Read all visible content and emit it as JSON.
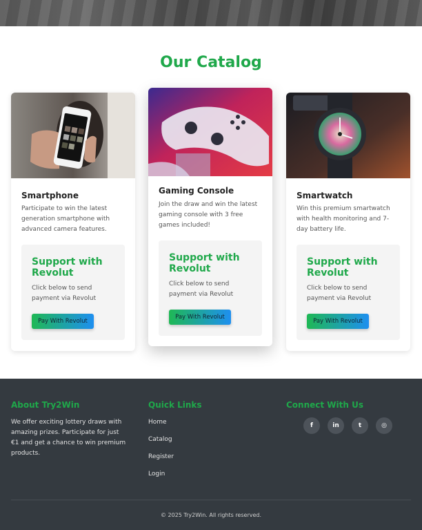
{
  "page": {
    "title": "Our Catalog"
  },
  "products": [
    {
      "title": "Smartphone",
      "description": "Participate to win the latest generation smartphone with advanced camera features.",
      "image_icon": "smartphone-photo",
      "support_title": "Support with Revolut",
      "support_text": "Click below to send payment via Revolut",
      "button_label": "Pay With Revolut"
    },
    {
      "title": "Gaming Console",
      "description": "Join the draw and win the latest gaming console with 3 free games included!",
      "image_icon": "game-controller-photo",
      "support_title": "Support with Revolut",
      "support_text": "Click below to send payment via Revolut",
      "button_label": "Pay With Revolut"
    },
    {
      "title": "Smartwatch",
      "description": "Win this premium smartwatch with health monitoring and 7-day battery life.",
      "image_icon": "smartwatch-photo",
      "support_title": "Support with Revolut",
      "support_text": "Click below to send payment via Revolut",
      "button_label": "Pay With Revolut"
    }
  ],
  "footer": {
    "about_title": "About Try2Win",
    "about_text": "We offer exciting lottery draws with amazing prizes. Participate for just €1 and get a chance to win premium products.",
    "links_title": "Quick Links",
    "links": [
      "Home",
      "Catalog",
      "Register",
      "Login"
    ],
    "connect_title": "Connect With Us",
    "social": [
      {
        "icon": "facebook-icon",
        "glyph": "f"
      },
      {
        "icon": "linkedin-icon",
        "glyph": "in"
      },
      {
        "icon": "twitter-icon",
        "glyph": "t"
      },
      {
        "icon": "instagram-icon",
        "glyph": "◎"
      }
    ],
    "copyright": "© 2025 Try2Win. All rights reserved."
  },
  "colors": {
    "accent": "#1fa84a",
    "footer_bg": "#343a40",
    "button_start": "#1fb855",
    "button_end": "#1e8ff0"
  }
}
